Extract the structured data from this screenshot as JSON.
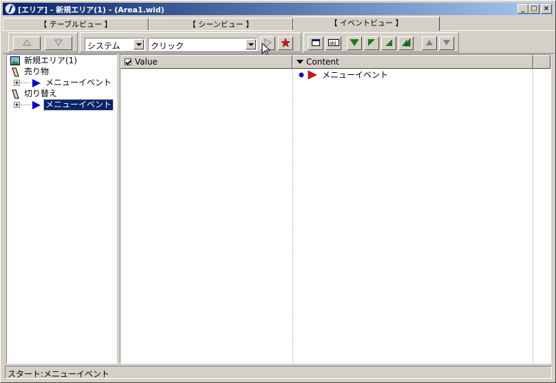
{
  "window": {
    "title": "[エリア] - 新規エリア(1) - (Area1.wid)",
    "minimize": "_",
    "maximize": "□",
    "close": "×"
  },
  "tabs": [
    {
      "label": "【 テーブルビュー 】",
      "active": false
    },
    {
      "label": "【 シーンビュー 】",
      "active": false
    },
    {
      "label": "【 イベントビュー 】",
      "active": true
    }
  ],
  "toolbar": {
    "system_combo": "システム",
    "event_combo": "クリック",
    "icons": [
      "up-arrow-icon",
      "down-arrow-icon",
      "play-icon",
      "delete-star-icon",
      "window-icon",
      "text-box-icon",
      "flag-fill-icon",
      "flag-icon",
      "triangle-icon",
      "double-triangle-icon",
      "move-up-icon",
      "move-down-icon"
    ]
  },
  "tree": {
    "nodes": [
      {
        "label": "新規エリア(1)",
        "icon": "area-image-icon"
      },
      {
        "label": "売り物",
        "icon": "item-icon"
      },
      {
        "label": "メニューイベント",
        "icon": "blue-arrow-icon"
      },
      {
        "label": "切り替え",
        "icon": "item-icon"
      },
      {
        "label": "メニューイベント",
        "icon": "blue-arrow-icon",
        "selected": true
      }
    ]
  },
  "grid": {
    "columns": [
      {
        "label": "Value"
      },
      {
        "label": "Content"
      }
    ],
    "rows": [
      {
        "value": "",
        "content": "メニューイベント"
      }
    ]
  },
  "status": {
    "text": "スタート:メニューイベント"
  },
  "colors": {
    "title_start": "#0a246a",
    "title_end": "#a6caf0",
    "face": "#d4d0c8",
    "selection": "#0a246a",
    "flag_green": "#1a7a1a",
    "event_red": "#e01010",
    "tree_blue": "#0000c8"
  }
}
